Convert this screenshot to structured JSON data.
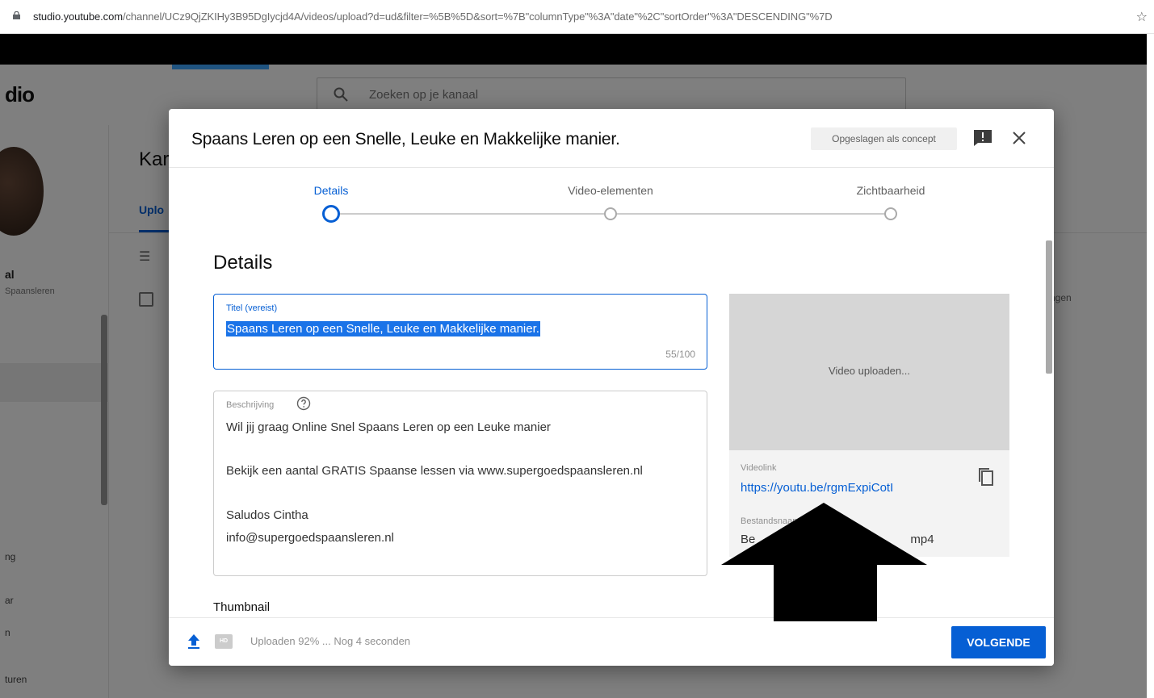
{
  "browser": {
    "url_host": "studio.youtube.com",
    "url_path": "/channel/UCz9QjZKIHy3B95DgIycjd4A/videos/upload?d=ud&filter=%5B%5D&sort=%7B\"columnType\"%3A\"date\"%2C\"sortOrder\"%3A\"DESCENDING\"%7D"
  },
  "studio": {
    "logo": "dio",
    "search_placeholder": "Zoeken op je kanaal",
    "page_title": "Kar",
    "tab": "Uplo",
    "channel_name": "al",
    "channel_sub": "Spaansleren",
    "sidebar_items": [
      "ng",
      "ar",
      "n",
      "turen"
    ],
    "right_col": "ngen"
  },
  "modal": {
    "title": "Spaans Leren op een Snelle, Leuke en Makkelijke manier.",
    "saved_badge": "Opgeslagen als concept",
    "steps": [
      {
        "label": "Details",
        "active": true
      },
      {
        "label": "Video-elementen",
        "active": false
      },
      {
        "label": "Zichtbaarheid",
        "active": false
      }
    ],
    "section_title": "Details",
    "title_field": {
      "label": "Titel (vereist)",
      "value": "Spaans Leren op een Snelle, Leuke en Makkelijke manier.",
      "counter": "55/100"
    },
    "description_field": {
      "label": "Beschrijving",
      "lines": [
        "Wil jij graag Online Snel Spaans Leren op een Leuke manier",
        "Bekijk een aantal GRATIS Spaanse lessen via www.supergoedspaansleren.nl",
        "Saludos Cintha",
        "info@supergoedspaansleren.nl"
      ]
    },
    "thumbnail_label": "Thumbnail",
    "preview": {
      "status": "Video uploaden...",
      "link_label": "Videolink",
      "link": "https://youtu.be/rgmExpiCotI",
      "file_label": "Bestandsnaam",
      "file_name_start": "Be",
      "file_name_end": "mp4"
    },
    "footer": {
      "hd_badge": "HD",
      "status": "Uploaden 92% ... Nog 4 seconden",
      "next_button": "VOLGENDE"
    }
  },
  "colors": {
    "accent": "#065fd4",
    "selection": "#1a73e8",
    "overlay": "#000000"
  }
}
